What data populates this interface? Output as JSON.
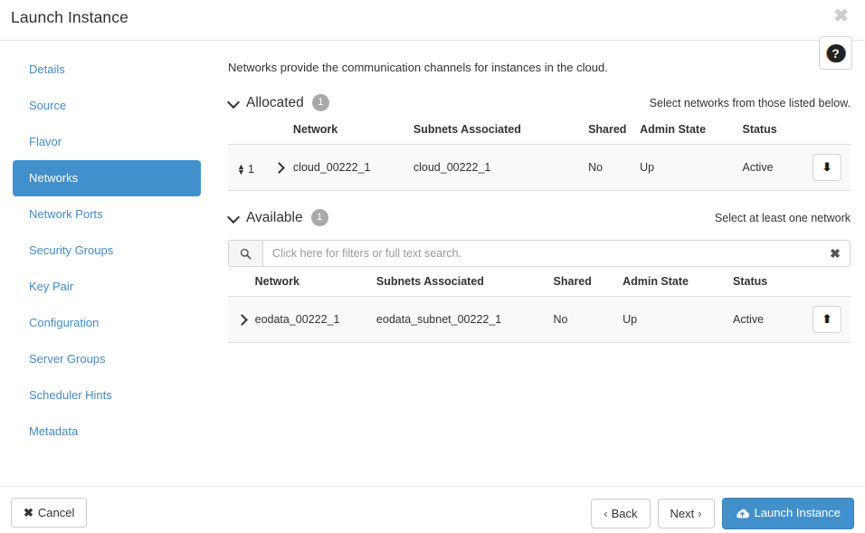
{
  "header": {
    "title": "Launch Instance",
    "close_label": "✖",
    "help_glyph": "?"
  },
  "sidebar": {
    "items": [
      {
        "label": "Details",
        "active": false
      },
      {
        "label": "Source",
        "active": false
      },
      {
        "label": "Flavor",
        "active": false
      },
      {
        "label": "Networks",
        "active": true
      },
      {
        "label": "Network Ports",
        "active": false
      },
      {
        "label": "Security Groups",
        "active": false
      },
      {
        "label": "Key Pair",
        "active": false
      },
      {
        "label": "Configuration",
        "active": false
      },
      {
        "label": "Server Groups",
        "active": false
      },
      {
        "label": "Scheduler Hints",
        "active": false
      },
      {
        "label": "Metadata",
        "active": false
      }
    ]
  },
  "main": {
    "intro": "Networks provide the communication channels for instances in the cloud.",
    "allocated": {
      "title": "Allocated",
      "count": "1",
      "hint": "Select networks from those listed below.",
      "columns": [
        "Network",
        "Subnets Associated",
        "Shared",
        "Admin State",
        "Status"
      ],
      "rows": [
        {
          "index": "1",
          "network": "cloud_00222_1",
          "subnets": "cloud_00222_1",
          "shared": "No",
          "admin_state": "Up",
          "status": "Active",
          "action_icon": "arrow-down-icon",
          "action_glyph": "⬇"
        }
      ]
    },
    "available": {
      "title": "Available",
      "count": "1",
      "hint": "Select at least one network",
      "search_placeholder": "Click here for filters or full text search.",
      "search_value": "",
      "search_clear_label": "✖",
      "columns": [
        "Network",
        "Subnets Associated",
        "Shared",
        "Admin State",
        "Status"
      ],
      "rows": [
        {
          "network": "eodata_00222_1",
          "subnets": "eodata_subnet_00222_1",
          "shared": "No",
          "admin_state": "Up",
          "status": "Active",
          "action_icon": "arrow-up-icon",
          "action_glyph": "⬆"
        }
      ]
    }
  },
  "footer": {
    "cancel_label": "Cancel",
    "cancel_glyph": "✖",
    "back_label": "Back",
    "back_caret": "‹",
    "next_label": "Next",
    "next_caret": "›",
    "launch_label": "Launch Instance"
  },
  "colors": {
    "accent": "#4190cb",
    "link": "#428bca",
    "badge": "#a9a9a9",
    "row_bg": "#f9f9f9",
    "border": "#dddddd"
  }
}
